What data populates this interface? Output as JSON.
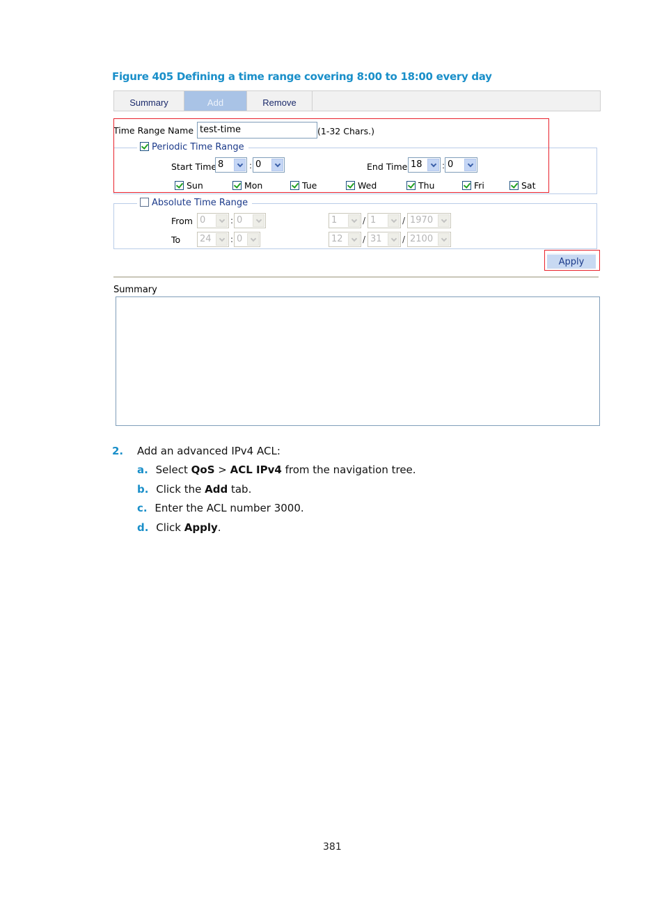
{
  "figure": {
    "title": "Figure 405 Defining a time range covering 8:00 to 18:00 every day"
  },
  "tabs": [
    {
      "label": "Summary",
      "active": false
    },
    {
      "label": "Add",
      "active": true
    },
    {
      "label": "Remove",
      "active": false
    }
  ],
  "form": {
    "name_label": "Time Range Name",
    "name_value": "test-time",
    "name_hint": "(1-32 Chars.)",
    "periodic": {
      "legend": "Periodic Time Range",
      "checked": true,
      "start_label": "Start Time",
      "start_hour": "8",
      "start_minute": "0",
      "end_label": "End Time",
      "end_hour": "18",
      "end_minute": "0",
      "days": [
        {
          "label": "Sun",
          "checked": true
        },
        {
          "label": "Mon",
          "checked": true
        },
        {
          "label": "Tue",
          "checked": true
        },
        {
          "label": "Wed",
          "checked": true
        },
        {
          "label": "Thu",
          "checked": true
        },
        {
          "label": "Fri",
          "checked": true
        },
        {
          "label": "Sat",
          "checked": true
        }
      ]
    },
    "absolute": {
      "legend": "Absolute Time Range",
      "checked": false,
      "from_label": "From",
      "to_label": "To",
      "from": {
        "hour": "0",
        "minute": "0",
        "month": "1",
        "day": "1",
        "year": "1970"
      },
      "to": {
        "hour": "24",
        "minute": "0",
        "month": "12",
        "day": "31",
        "year": "2100"
      },
      "time_sep": ":",
      "date_sep": "/"
    },
    "apply_label": "Apply"
  },
  "summary": {
    "label": "Summary"
  },
  "steps": {
    "main_num": "2.",
    "main_text": "Add an advanced IPv4 ACL:",
    "sub": [
      {
        "num": "a.",
        "pre": "Select ",
        "b1": "QoS",
        "mid": " > ",
        "b2": "ACL IPv4",
        "post": " from the navigation tree."
      },
      {
        "num": "b.",
        "pre": "Click the ",
        "b1": "Add",
        "post": " tab."
      },
      {
        "num": "c.",
        "text": "Enter the ACL number 3000."
      },
      {
        "num": "d.",
        "pre": "Click ",
        "b1": "Apply",
        "post": "."
      }
    ]
  },
  "page_number": "381"
}
